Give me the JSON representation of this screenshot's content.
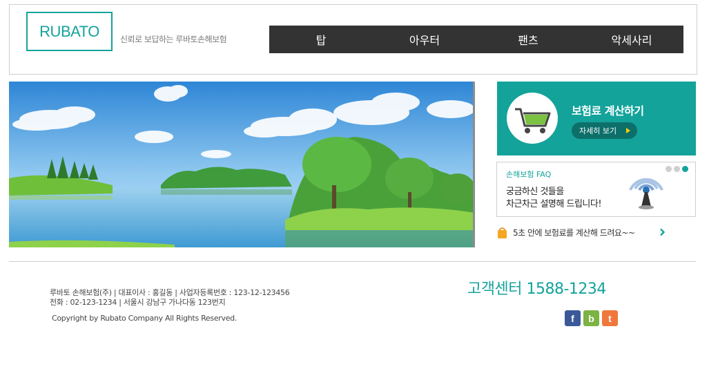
{
  "header": {
    "logo": "RUBATO",
    "slogan": "신뢰로 보답하는 루바토손해보험",
    "nav": [
      {
        "label": "탑"
      },
      {
        "label": "아우터"
      },
      {
        "label": "팬츠"
      },
      {
        "label": "악세사리"
      }
    ]
  },
  "promo": {
    "title": "보험료 계산하기",
    "button": "자세히 보기",
    "icon": "shopping-cart-icon"
  },
  "faq": {
    "title": "손해보험 FAQ",
    "line1": "궁금하신 것들을",
    "line2": "차근차근 설명해 드립니다!",
    "icon": "signal-tower-icon"
  },
  "notice": {
    "text": "5초 안에 보험료를 계산해 드려요~~"
  },
  "footer": {
    "info_line1": "루바토 손해보험(주) | 대표이사 : 홍길동 | 사업자등록번호 : 123-12-123456",
    "info_line2": "전화 : 02-123-1234 | 서울시 강남구 가나다동 123번지",
    "copyright": "Copyright by Rubato Company All Rights Reserved.",
    "cs_center": "고객센터 1588-1234",
    "social": [
      {
        "label": "f",
        "color": "#3b5998"
      },
      {
        "label": "b",
        "color": "#7cb342"
      },
      {
        "label": "t",
        "color": "#f0783c"
      }
    ]
  },
  "colors": {
    "accent": "#13a39a",
    "nav_bg": "#333333"
  }
}
